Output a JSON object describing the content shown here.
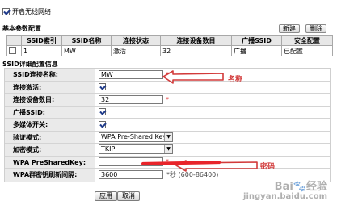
{
  "wireless": {
    "enable_label": "开启无线网络",
    "enabled": true
  },
  "basic": {
    "title": "基本参数配置",
    "new_button": "新建",
    "delete_button": "删除",
    "headers": [
      "",
      "SSID索引",
      "SSID名称",
      "连接状态",
      "连接设备数目",
      "广播SSID",
      "安全配置"
    ],
    "rows": [
      {
        "index": "1",
        "name": "MW",
        "status": "激活",
        "devices": "32",
        "broadcast": "广播",
        "security": "已配置"
      }
    ]
  },
  "detail": {
    "title": "SSID详细配置信息",
    "ssid_name_label": "SSID连接名称:",
    "ssid_name_value": "MW",
    "active_label": "连接激活:",
    "devices_label": "连接设备数目:",
    "devices_value": "32",
    "broadcast_label": "广播SSID:",
    "multimedia_label": "多媒体开关:",
    "auth_label": "验证模式:",
    "auth_value": "WPA Pre-Shared Key",
    "encrypt_label": "加密模式:",
    "encrypt_value": "TKIP",
    "psk_label": "WPA PreSharedKey:",
    "rekey_label": "WPA群密钥刷新间隔:",
    "rekey_value": "3600",
    "rekey_hint": "*秒 (600-86400)",
    "required_mark": "*"
  },
  "annotations": {
    "name_label": "名称",
    "password_label": "密码",
    "color": "#d23a3a"
  },
  "actions": {
    "apply": "应用",
    "cancel": "取消"
  },
  "watermark": {
    "line1": "Bai🐾经验",
    "line2": "jingyan.baidu.com"
  }
}
